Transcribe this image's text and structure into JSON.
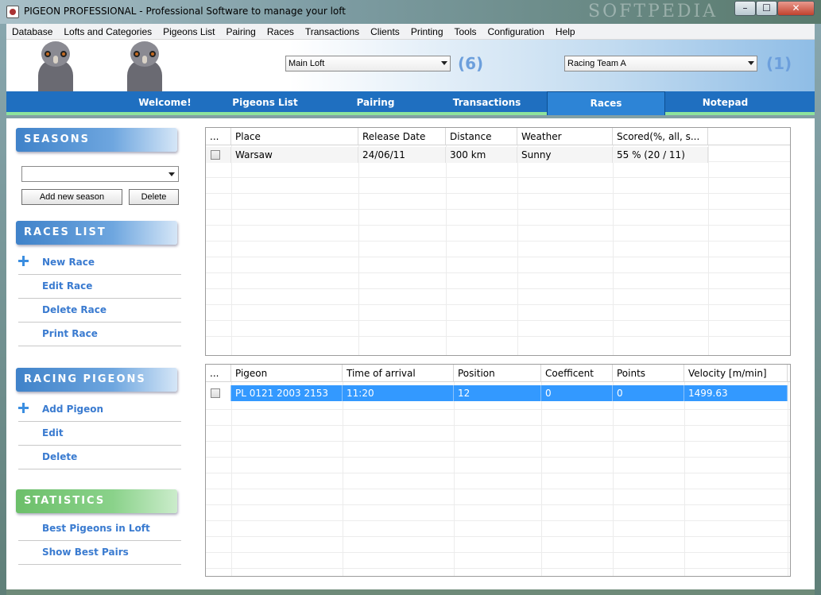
{
  "window": {
    "title": "PIGEON PROFESSIONAL - Professional Software to manage your loft",
    "watermark": "SOFTPEDIA",
    "controls": {
      "minimize": "–",
      "maximize": "☐",
      "close": "✕"
    }
  },
  "menu": [
    "Database",
    "Lofts and Categories",
    "Pigeons List",
    "Pairing",
    "Races",
    "Transactions",
    "Clients",
    "Printing",
    "Tools",
    "Configuration",
    "Help"
  ],
  "header": {
    "loft_select": "Main Loft",
    "loft_count": "(6)",
    "team_select": "Racing Team A",
    "team_count": "(1)"
  },
  "tabs": [
    {
      "label": "Welcome!",
      "active": false
    },
    {
      "label": "Pigeons List",
      "active": false
    },
    {
      "label": "Pairing",
      "active": false
    },
    {
      "label": "Transactions",
      "active": false
    },
    {
      "label": "Races",
      "active": true
    },
    {
      "label": "Notepad",
      "active": false
    }
  ],
  "sidebar": {
    "seasons": {
      "title": "SEASONS",
      "season_value": "",
      "add_button": "Add new season",
      "delete_button": "Delete"
    },
    "races_list": {
      "title": "RACES LIST",
      "items": [
        "New Race",
        "Edit Race",
        "Delete Race",
        "Print Race"
      ]
    },
    "racing_pigeons": {
      "title": "RACING PIGEONS",
      "items": [
        "Add Pigeon",
        "Edit",
        "Delete"
      ]
    },
    "statistics": {
      "title": "STATISTICS",
      "items": [
        "Best Pigeons in Loft",
        "Show Best Pairs"
      ]
    }
  },
  "races_grid": {
    "columns": [
      "...",
      "Place",
      "Release Date",
      "Distance",
      "Weather",
      "Scored(%, all, s..."
    ],
    "rows": [
      {
        "place": "Warsaw",
        "release_date": "24/06/11",
        "distance": "300 km",
        "weather": "Sunny",
        "scored": "55 %   (20 / 11)"
      }
    ]
  },
  "pigeons_grid": {
    "columns": [
      "...",
      "Pigeon",
      "Time of arrival",
      "Position",
      "Coefficent",
      "Points",
      "Velocity [m/min]"
    ],
    "rows": [
      {
        "pigeon": "PL 0121 2003 2153",
        "time": "11:20",
        "position": "12",
        "coefficient": "0",
        "points": "0",
        "velocity": "1499.63"
      }
    ]
  },
  "colors": {
    "tab_bar": "#1f6fc0",
    "tab_underline": "#8ee39d",
    "link": "#3a7bd0",
    "count": "#6c9fdc",
    "selection": "#3399ff",
    "section_blue": "#3f82c9",
    "section_green": "#6cbf6a"
  }
}
